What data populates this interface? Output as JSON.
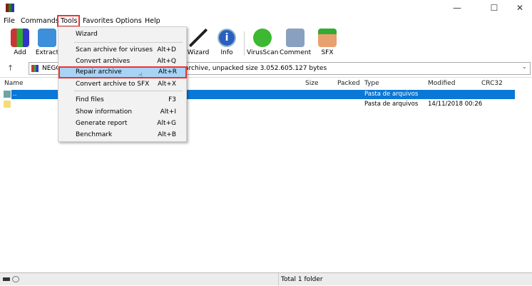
{
  "menubar": {
    "items": [
      "File",
      "Commands",
      "Tools",
      "Favorites",
      "Options",
      "Help"
    ]
  },
  "toolbar": {
    "buttons": [
      "Add",
      "Extract",
      "Wizard",
      "Info",
      "VirusScan",
      "Comment",
      "SFX"
    ]
  },
  "address": {
    "prefix": "NEGC",
    "text": "archive, unpacked size 3.052.605.127 bytes"
  },
  "columns": [
    "Name",
    "Size",
    "Packed",
    "Type",
    "Modified",
    "CRC32"
  ],
  "rows": [
    {
      "name": "..",
      "type": "Pasta de arquivos",
      "modified": ""
    },
    {
      "name": "",
      "type": "Pasta de arquivos",
      "modified": "14/11/2018 00:26"
    }
  ],
  "tools_menu": [
    {
      "label": "Wizard",
      "key": ""
    },
    {
      "label": "Scan archive for viruses",
      "key": "Alt+D"
    },
    {
      "label": "Convert archives",
      "key": "Alt+Q"
    },
    {
      "label": "Repair archive",
      "key": "Alt+R"
    },
    {
      "label": "Convert archive to SFX",
      "key": "Alt+X"
    },
    {
      "label": "Find files",
      "key": "F3"
    },
    {
      "label": "Show information",
      "key": "Alt+I"
    },
    {
      "label": "Generate report",
      "key": "Alt+G"
    },
    {
      "label": "Benchmark",
      "key": "Alt+B"
    }
  ],
  "status": {
    "text": "Total 1 folder"
  },
  "colors": {
    "selection": "#0a78d7",
    "highlight": "#a9d3f5",
    "callout": "#e33333"
  }
}
